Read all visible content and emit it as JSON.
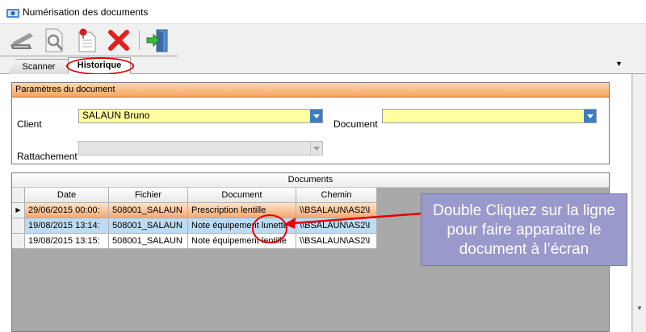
{
  "window": {
    "title": "Numérisation des documents"
  },
  "toolbar": {
    "icons": [
      "scanner-icon",
      "preview-icon",
      "document-pin-icon",
      "delete-icon",
      "exit-icon"
    ]
  },
  "tabs": [
    {
      "label": "Scanner",
      "active": false
    },
    {
      "label": "Historique",
      "active": true
    }
  ],
  "params": {
    "header": "Paramètres du document",
    "client_label": "Client",
    "client_value": "SALAUN Bruno",
    "document_label": "Document",
    "document_value": "",
    "rattachement_label": "Rattachement",
    "rattachement_value": ""
  },
  "documents": {
    "header": "Documents",
    "columns": [
      "Date",
      "Fichier",
      "Document",
      "Chemin"
    ],
    "rows": [
      [
        "29/06/2015 00:00:",
        "508001_SALAUN",
        "Prescription lentille",
        "\\\\BSALAUN\\AS2\\I"
      ],
      [
        "19/08/2015 13:14:",
        "508001_SALAUN",
        "Note équipement lunette",
        "\\\\BSALAUN\\AS2\\I"
      ],
      [
        "19/08/2015 13:15:",
        "508001_SALAUN",
        "Note équipement lentille",
        "\\\\BSALAUN\\AS2\\I"
      ]
    ]
  },
  "callout": {
    "line1": "Double Cliquez sur la ligne",
    "line2": "pour faire apparaitre le",
    "line3": "document à l’écran"
  },
  "colors": {
    "accent_orange": "#f5a560",
    "combo_yellow": "#ffffa0",
    "callout_bg": "#9999cc",
    "marker_red": "#e60000",
    "hover_blue": "#bcdcf4"
  }
}
